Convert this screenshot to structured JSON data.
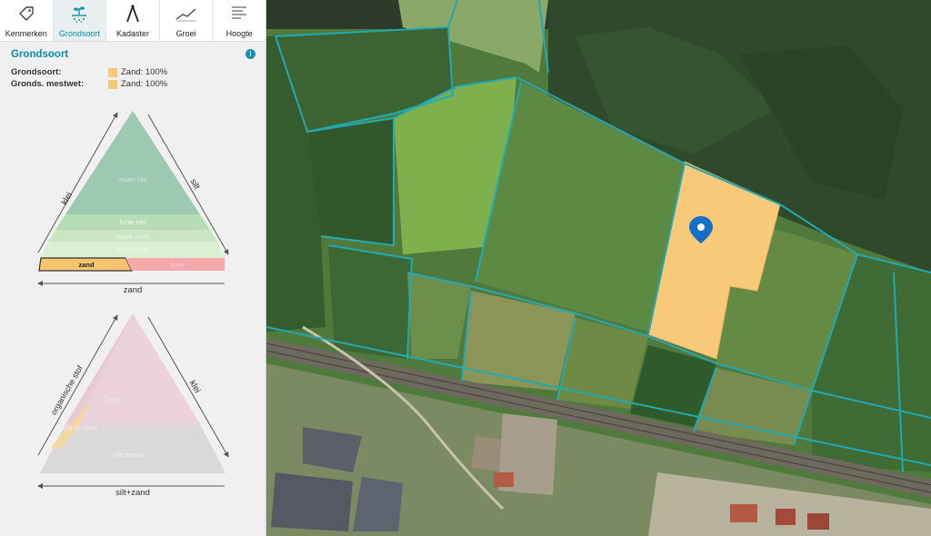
{
  "tabs": [
    {
      "label": "Kenmerken",
      "icon": "tag-icon",
      "active": false
    },
    {
      "label": "Grondsoort",
      "icon": "soil-plant-icon",
      "active": true
    },
    {
      "label": "Kadaster",
      "icon": "compass-icon",
      "active": false
    },
    {
      "label": "Groei",
      "icon": "growth-line-icon",
      "active": false
    },
    {
      "label": "Hoogte",
      "icon": "height-lines-icon",
      "active": false
    }
  ],
  "section": {
    "title": "Grondsoort",
    "info_icon": "info-icon"
  },
  "properties": [
    {
      "label": "Grondsoort:",
      "value": "Zand: 100%",
      "color": "#f5c97a"
    },
    {
      "label": "Gronds. mestwet:",
      "value": "Zand: 100%",
      "color": "#f5c97a"
    }
  ],
  "triangle_soil": {
    "left_axis": "klei",
    "right_axis": "silt",
    "bottom_axis": "zand",
    "zones": [
      "zware klei",
      "lichte klei",
      "zware zavel",
      "lichte zavel",
      "zand",
      "leem"
    ],
    "selected": "zand"
  },
  "triangle_organic": {
    "left_axis": "organische stof",
    "right_axis": "klei",
    "bottom_axis": "silt+zand",
    "zones": [
      "veen",
      "moerig op zand",
      "(zie boven)"
    ]
  },
  "map": {
    "selected_parcel_color": "#f9c97a",
    "parcel_outline_color": "#21a9b4",
    "marker": "map-pin-icon",
    "marker_color": "#1670c7"
  }
}
